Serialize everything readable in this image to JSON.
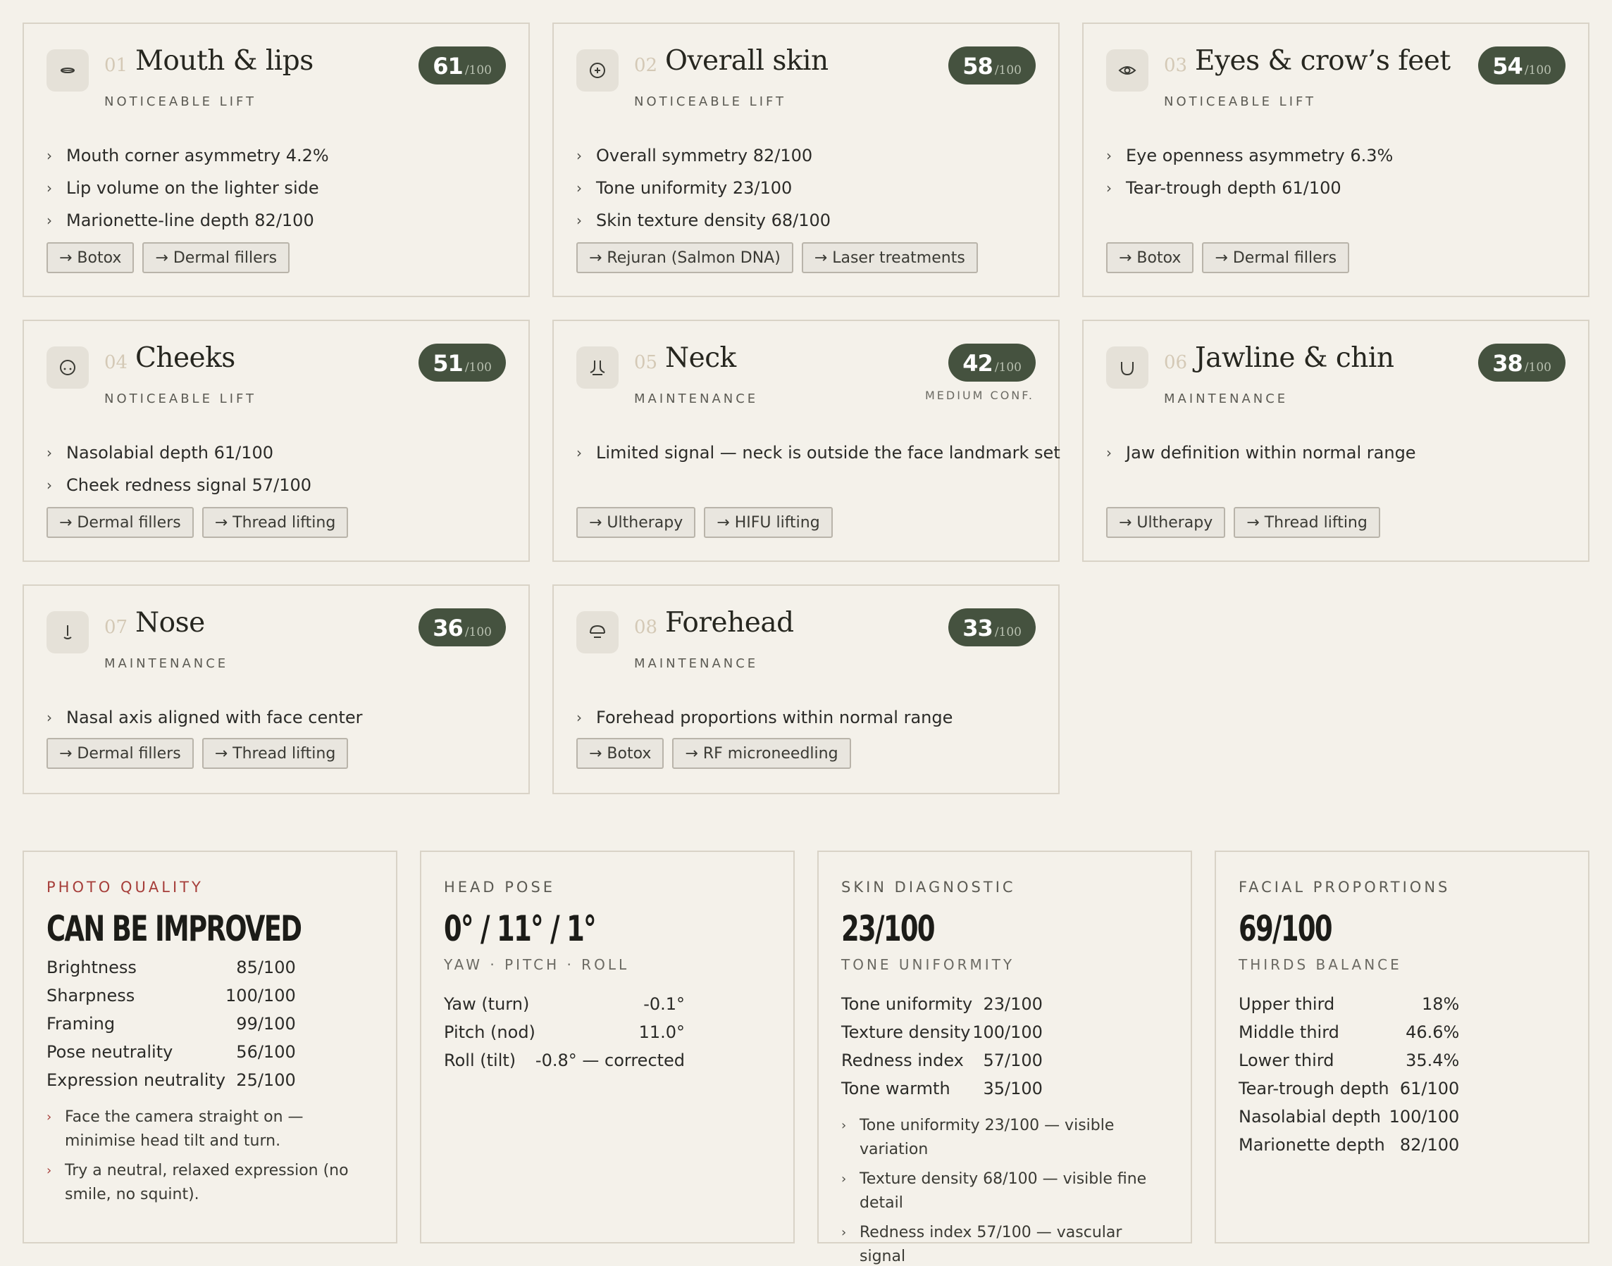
{
  "colors": {
    "background": "#f4f1ea",
    "score_pill": "#45523f",
    "card_border": "#d9d3c7",
    "accent_red": "#a63e3a"
  },
  "regions": [
    {
      "num": "01",
      "title": "Mouth & lips",
      "tier": "NOTICEABLE LIFT",
      "score": "61",
      "score_max": "/100",
      "confidence": "",
      "icon": "mouth-icon",
      "bullets": [
        "Mouth corner asymmetry 4.2%",
        "Lip volume on the lighter side",
        "Marionette-line depth 82/100"
      ],
      "treatments": [
        "→ Botox",
        "→ Dermal fillers"
      ]
    },
    {
      "num": "02",
      "title": "Overall skin",
      "tier": "NOTICEABLE LIFT",
      "score": "58",
      "score_max": "/100",
      "confidence": "",
      "icon": "skin-icon",
      "bullets": [
        "Overall symmetry 82/100",
        "Tone uniformity 23/100",
        "Skin texture density 68/100"
      ],
      "treatments": [
        "→ Rejuran (Salmon DNA)",
        "→ Laser treatments"
      ]
    },
    {
      "num": "03",
      "title": "Eyes & crow’s feet",
      "tier": "NOTICEABLE LIFT",
      "score": "54",
      "score_max": "/100",
      "confidence": "",
      "icon": "eye-icon",
      "bullets": [
        "Eye openness asymmetry 6.3%",
        "Tear-trough depth 61/100"
      ],
      "treatments": [
        "→ Botox",
        "→ Dermal fillers"
      ]
    },
    {
      "num": "04",
      "title": "Cheeks",
      "tier": "NOTICEABLE LIFT",
      "score": "51",
      "score_max": "/100",
      "confidence": "",
      "icon": "cheeks-icon",
      "bullets": [
        "Nasolabial depth 61/100",
        "Cheek redness signal 57/100"
      ],
      "treatments": [
        "→ Dermal fillers",
        "→ Thread lifting"
      ]
    },
    {
      "num": "05",
      "title": "Neck",
      "tier": "MAINTENANCE",
      "score": "42",
      "score_max": "/100",
      "confidence": "MEDIUM CONF.",
      "icon": "neck-icon",
      "bullets": [
        "Limited signal — neck is outside the face landmark set"
      ],
      "treatments": [
        "→ Ultherapy",
        "→ HIFU lifting"
      ]
    },
    {
      "num": "06",
      "title": "Jawline & chin",
      "tier": "MAINTENANCE",
      "score": "38",
      "score_max": "/100",
      "confidence": "",
      "icon": "jawline-icon",
      "bullets": [
        "Jaw definition within normal range"
      ],
      "treatments": [
        "→ Ultherapy",
        "→ Thread lifting"
      ]
    },
    {
      "num": "07",
      "title": "Nose",
      "tier": "MAINTENANCE",
      "score": "36",
      "score_max": "/100",
      "confidence": "",
      "icon": "nose-icon",
      "bullets": [
        "Nasal axis aligned with face center"
      ],
      "treatments": [
        "→ Dermal fillers",
        "→ Thread lifting"
      ]
    },
    {
      "num": "08",
      "title": "Forehead",
      "tier": "MAINTENANCE",
      "score": "33",
      "score_max": "/100",
      "confidence": "",
      "icon": "forehead-icon",
      "bullets": [
        "Forehead proportions within normal range"
      ],
      "treatments": [
        "→ Botox",
        "→ RF microneedling"
      ]
    }
  ],
  "photo_quality": {
    "label": "PHOTO QUALITY",
    "headline": "CAN BE IMPROVED",
    "rows": [
      {
        "k": "Brightness",
        "v": "85/100"
      },
      {
        "k": "Sharpness",
        "v": "100/100"
      },
      {
        "k": "Framing",
        "v": "99/100"
      },
      {
        "k": "Pose neutrality",
        "v": "56/100"
      },
      {
        "k": "Expression neutrality",
        "v": "25/100"
      }
    ],
    "notes": [
      "Face the camera straight on — minimise head tilt and turn.",
      "Try a neutral, relaxed expression (no smile, no squint)."
    ]
  },
  "head_pose": {
    "label": "HEAD POSE",
    "headline": "0° / 11° / 1°",
    "sub": "YAW · PITCH · ROLL",
    "rows": [
      {
        "k": "Yaw (turn)",
        "v": "-0.1°"
      },
      {
        "k": "Pitch (nod)",
        "v": "11.0°"
      },
      {
        "k": "Roll (tilt)",
        "v": "-0.8° — corrected"
      }
    ]
  },
  "skin_diagnostic": {
    "label": "SKIN DIAGNOSTIC",
    "headline": "23/100",
    "sub": "TONE UNIFORMITY",
    "rows": [
      {
        "k": "Tone uniformity",
        "v": "23/100"
      },
      {
        "k": "Texture density",
        "v": "100/100"
      },
      {
        "k": "Redness index",
        "v": "57/100"
      },
      {
        "k": "Tone warmth",
        "v": "35/100"
      }
    ],
    "notes": [
      "Tone uniformity 23/100 — visible variation",
      "Texture density 68/100 — visible fine detail",
      "Redness index 57/100 — vascular signal"
    ]
  },
  "facial_proportions": {
    "label": "FACIAL PROPORTIONS",
    "headline": "69/100",
    "sub": "THIRDS BALANCE",
    "rows": [
      {
        "k": "Upper third",
        "v": "18%"
      },
      {
        "k": "Middle third",
        "v": "46.6%"
      },
      {
        "k": "Lower third",
        "v": "35.4%"
      },
      {
        "k": "Tear-trough depth",
        "v": "61/100"
      },
      {
        "k": "Nasolabial depth",
        "v": "100/100"
      },
      {
        "k": "Marionette depth",
        "v": "82/100"
      }
    ]
  }
}
